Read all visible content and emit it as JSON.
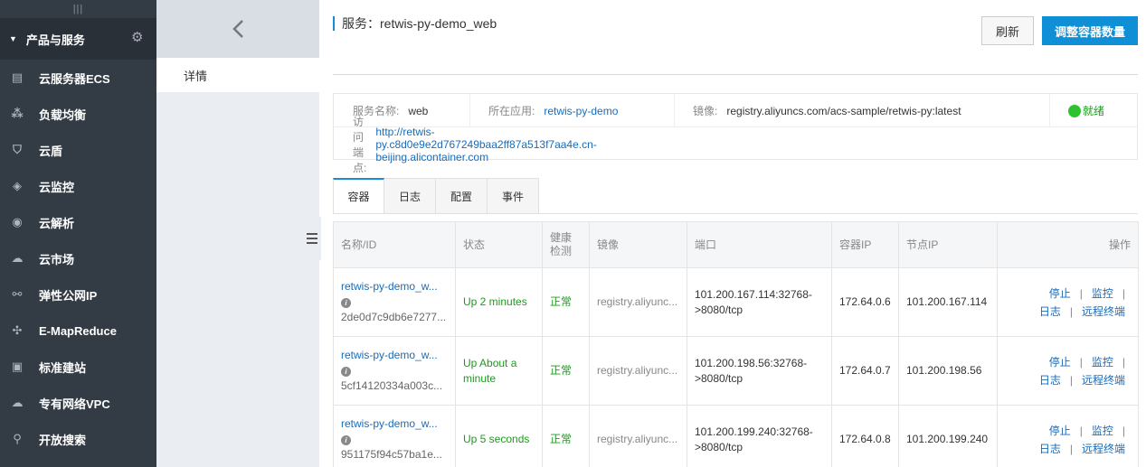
{
  "sidebar": {
    "header": "产品与服务",
    "items": [
      {
        "label": "云服务器ECS",
        "icon": "server-icon"
      },
      {
        "label": "负载均衡",
        "icon": "load-balancer-icon"
      },
      {
        "label": "云盾",
        "icon": "shield-icon"
      },
      {
        "label": "云监控",
        "icon": "monitor-icon"
      },
      {
        "label": "云解析",
        "icon": "dns-icon"
      },
      {
        "label": "云市场",
        "icon": "market-icon"
      },
      {
        "label": "弹性公网IP",
        "icon": "elastic-ip-icon"
      },
      {
        "label": "E-MapReduce",
        "icon": "mapreduce-icon"
      },
      {
        "label": "标准建站",
        "icon": "website-icon"
      },
      {
        "label": "专有网络VPC",
        "icon": "cloud-vpc-icon"
      },
      {
        "label": "开放搜索",
        "icon": "search-icon"
      }
    ]
  },
  "subnav": {
    "item": "详情"
  },
  "header": {
    "title": "服务：retwis-py-demo_web",
    "refresh_label": "刷新",
    "scale_label": "调整容器数量"
  },
  "info": {
    "service_name_label": "服务名称:",
    "service_name": "web",
    "app_label": "所在应用:",
    "app": "retwis-py-demo",
    "image_label": "镜像:",
    "image": "registry.aliyuncs.com/acs-sample/retwis-py:latest",
    "status": "就绪",
    "endpoint_label": "访问端点:",
    "endpoint": "http://retwis-py.c8d0e9e2d767249baa2ff87a513f7aa4e.cn-beijing.alicontainer.com",
    "status_color": "#2fc22f"
  },
  "tabs": [
    "容器",
    "日志",
    "配置",
    "事件"
  ],
  "table": {
    "headers": [
      "名称/ID",
      "状态",
      "健康检测",
      "镜像",
      "端口",
      "容器IP",
      "节点IP",
      "操作"
    ],
    "rows": [
      {
        "name": "retwis-py-demo_w...",
        "id": "2de0d7c9db6e7277...",
        "status": "Up 2 minutes",
        "health": "正常",
        "image": "registry.aliyunc...",
        "port": "101.200.167.114:32768->8080/tcp",
        "cip": "172.64.0.6",
        "nip": "101.200.167.114"
      },
      {
        "name": "retwis-py-demo_w...",
        "id": "5cf14120334a003c...",
        "status": "Up About a minute",
        "health": "正常",
        "image": "registry.aliyunc...",
        "port": "101.200.198.56:32768->8080/tcp",
        "cip": "172.64.0.7",
        "nip": "101.200.198.56"
      },
      {
        "name": "retwis-py-demo_w...",
        "id": "951175f94c57ba1e...",
        "status": "Up 5 seconds",
        "health": "正常",
        "image": "registry.aliyunc...",
        "port": "101.200.199.240:32768->8080/tcp",
        "cip": "172.64.0.8",
        "nip": "101.200.199.240"
      }
    ],
    "ops": {
      "stop": "停止",
      "monitor": "监控",
      "log": "日志",
      "terminal": "远程终端",
      "sep": "|"
    }
  },
  "colors": {
    "accent": "#0f8fd6",
    "sidebar": "#333b45",
    "ok": "#1d9a1d"
  }
}
